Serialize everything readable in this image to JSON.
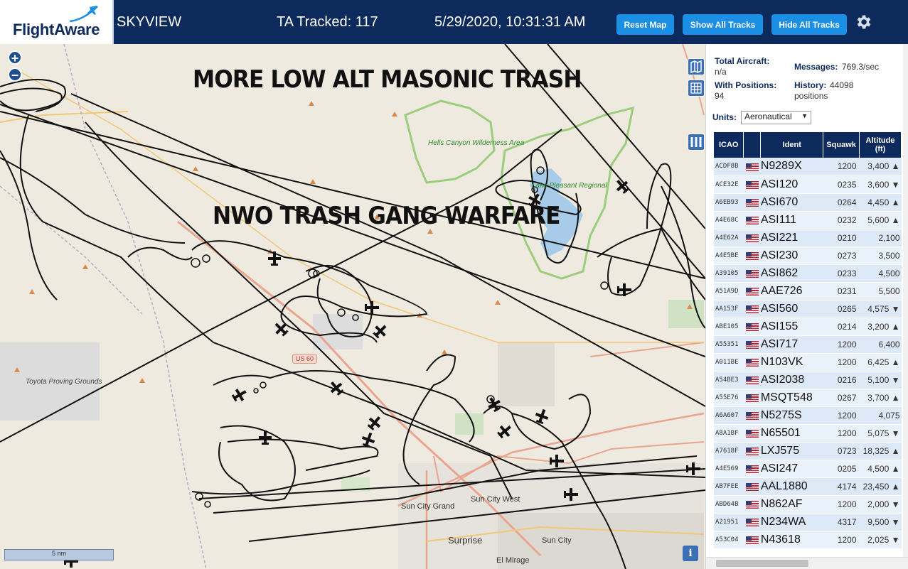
{
  "header": {
    "logo_text": "FlightAware",
    "app_title": "SKYVIEW",
    "tracked": "TA Tracked: 117",
    "datetime": "5/29/2020, 10:31:31 AM",
    "buttons": {
      "reset": "Reset Map",
      "show_all": "Show All Tracks",
      "hide_all": "Hide All Tracks"
    },
    "settings_icon": "gear-icon",
    "colors": {
      "bar": "#0d2a5c",
      "button": "#1a8fe3"
    }
  },
  "map": {
    "overlay_top": "MORE LOW ALT MASONIC TRASH",
    "overlay_mid": "NWO TRASH GANG WARFARE",
    "labels": {
      "hells_canyon": "Hells Canyon Wilderness Area",
      "lake_pleasant": "Lake Pleasant Regional",
      "toyota": "Toyota Proving Grounds",
      "sun_city_grand": "Sun City Grand",
      "sun_city_west": "Sun City West",
      "sun_city": "Sun City",
      "surprise": "Surprise",
      "el_mirage": "El Mirage",
      "route": "US 60"
    },
    "scale": "5 nm",
    "zoom_in": "+",
    "zoom_out": "−",
    "info": "i"
  },
  "stats": {
    "total_label": "Total Aircraft:",
    "total_val": "n/a",
    "messages_label": "Messages:",
    "messages_val": "769.3/sec",
    "positions_label": "With Positions:",
    "positions_val": "94",
    "history_label": "History:",
    "history_val": "44098",
    "history_unit": "positions"
  },
  "units": {
    "label": "Units:",
    "selected": "Aeronautical"
  },
  "table": {
    "headers": {
      "icao": "ICAO",
      "flag": "",
      "ident": "Ident",
      "squawk": "Squawk",
      "altitude": "Altitude (ft)"
    },
    "rows": [
      {
        "icao": "ACDF8B",
        "ident": "N9289X",
        "squawk": "1200",
        "alt": "3,400 ▲"
      },
      {
        "icao": "ACE32E",
        "ident": "ASI120",
        "squawk": "0235",
        "alt": "3,600 ▼"
      },
      {
        "icao": "A6EB93",
        "ident": "ASI670",
        "squawk": "0264",
        "alt": "4,450 ▲"
      },
      {
        "icao": "A4E68C",
        "ident": "ASI111",
        "squawk": "0232",
        "alt": "5,600 ▲"
      },
      {
        "icao": "A4E62A",
        "ident": "ASI221",
        "squawk": "0210",
        "alt": "2,100"
      },
      {
        "icao": "A4E5BE",
        "ident": "ASI230",
        "squawk": "0273",
        "alt": "3,500"
      },
      {
        "icao": "A39105",
        "ident": "ASI862",
        "squawk": "0233",
        "alt": "4,500"
      },
      {
        "icao": "A51A9D",
        "ident": "AAE726",
        "squawk": "0231",
        "alt": "5,500"
      },
      {
        "icao": "AA153F",
        "ident": "ASI560",
        "squawk": "0265",
        "alt": "4,575 ▼"
      },
      {
        "icao": "ABE105",
        "ident": "ASI155",
        "squawk": "0214",
        "alt": "3,200 ▲"
      },
      {
        "icao": "A55351",
        "ident": "ASI717",
        "squawk": "1200",
        "alt": "6,400"
      },
      {
        "icao": "A011BE",
        "ident": "N103VK",
        "squawk": "1200",
        "alt": "6,425 ▲"
      },
      {
        "icao": "A54BE3",
        "ident": "ASI2038",
        "squawk": "0216",
        "alt": "5,100 ▼"
      },
      {
        "icao": "A55E76",
        "ident": "MSQT548",
        "squawk": "0267",
        "alt": "3,700 ▲"
      },
      {
        "icao": "A6A607",
        "ident": "N5275S",
        "squawk": "1200",
        "alt": "4,075"
      },
      {
        "icao": "A8A1BF",
        "ident": "N65501",
        "squawk": "1200",
        "alt": "5,075 ▼"
      },
      {
        "icao": "A7618F",
        "ident": "LXJ575",
        "squawk": "0723",
        "alt": "18,325 ▲"
      },
      {
        "icao": "A4E569",
        "ident": "ASI247",
        "squawk": "0205",
        "alt": "4,500 ▲"
      },
      {
        "icao": "AB7FEE",
        "ident": "AAL1880",
        "squawk": "4174",
        "alt": "23,450 ▲"
      },
      {
        "icao": "ABD64B",
        "ident": "N862AF",
        "squawk": "1200",
        "alt": "2,000 ▼"
      },
      {
        "icao": "A21951",
        "ident": "N234WA",
        "squawk": "4317",
        "alt": "9,500 ▼"
      },
      {
        "icao": "A53C04",
        "ident": "N43618",
        "squawk": "1200",
        "alt": "2,025 ▼"
      }
    ]
  }
}
